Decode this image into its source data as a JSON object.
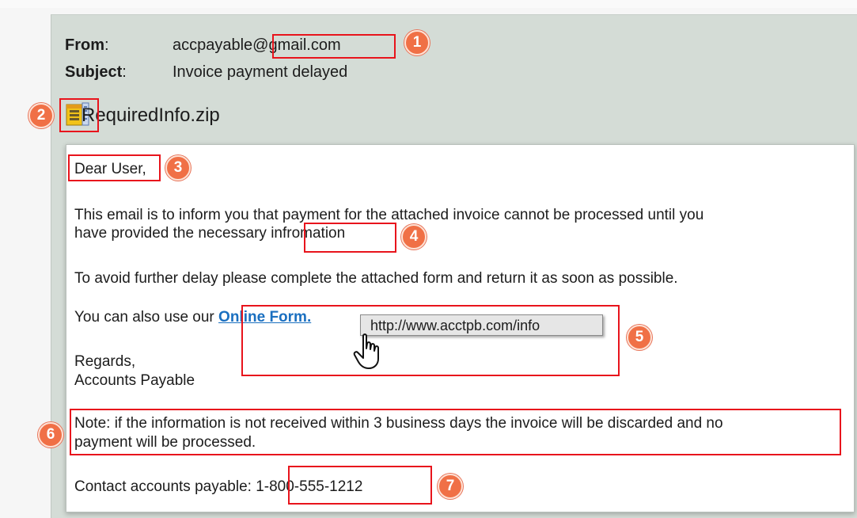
{
  "email": {
    "from_label": "From",
    "from_colon": ":",
    "from_value": "accpayable@gmail.com",
    "subject_label": "Subject",
    "subject_colon": ":",
    "subject_value": "Invoice payment delayed",
    "attachment": {
      "name": "RequiredInfo.zip",
      "icon": "zip-archive-icon"
    },
    "body": {
      "greeting": "Dear User,",
      "para1_line1": "This email is to inform you that payment for the attached invoice cannot be processed until you",
      "para1_line2": "have provided the necessary infromation",
      "para2": "To avoid further delay please complete the attached form and return it as soon as possible.",
      "para3_prefix": "You can also use our",
      "link_text": "Online Form.",
      "link_tooltip": "http://www.acctpb.com/info",
      "regards": "Regards,",
      "signature": "Accounts Payable",
      "note_line1": "Note: if the information is not received within 3 business days the invoice will be discarded and no",
      "note_line2": "payment will be processed.",
      "contact_prefix": "Contact accounts payable:",
      "contact_phone": "1-800-555-1212"
    }
  },
  "annotations": {
    "color": "#e8141c",
    "badge_color": "#f07046",
    "badges": [
      "1",
      "2",
      "3",
      "4",
      "5",
      "6",
      "7"
    ]
  }
}
